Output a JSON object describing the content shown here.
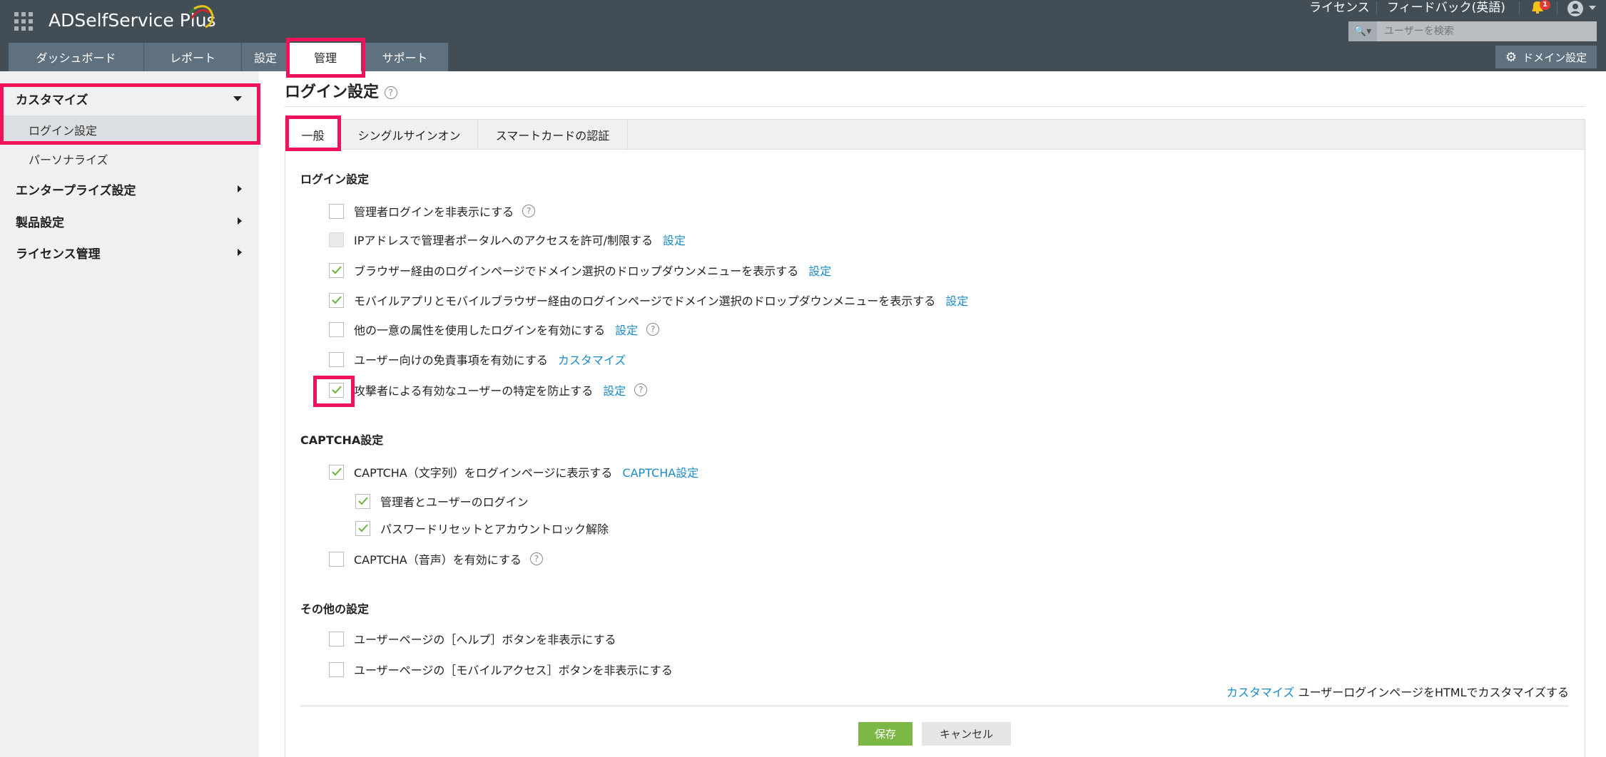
{
  "app": {
    "title": "ADSelfService Plus"
  },
  "top_links": {
    "license": "ライセンス",
    "feedback": "フィードバック(英語)",
    "notification_count": "1"
  },
  "search": {
    "placeholder": "ユーザーを検索"
  },
  "domain_settings": "ドメイン設定",
  "nav_tabs": [
    "ダッシュボード",
    "レポート",
    "設定",
    "管理",
    "サポート"
  ],
  "sidebar": {
    "customize": "カスタマイズ",
    "login_settings": "ログイン設定",
    "personalize": "パーソナライズ",
    "enterprise": "エンタープライズ設定",
    "product": "製品設定",
    "license": "ライセンス管理"
  },
  "page": {
    "title": "ログイン設定",
    "help": "?"
  },
  "content_tabs": [
    "一般",
    "シングルサインオン",
    "スマートカードの認証"
  ],
  "login_section": {
    "title": "ログイン設定",
    "items": [
      {
        "label": "管理者ログインを非表示にする",
        "checked": false
      },
      {
        "label": "IPアドレスで管理者ポータルへのアクセスを許可/制限する",
        "link": "設定",
        "checked": false
      },
      {
        "label": "ブラウザー経由のログインページでドメイン選択のドロップダウンメニューを表示する",
        "link": "設定",
        "checked": true
      },
      {
        "label": "モバイルアプリとモバイルブラウザー経由のログインページでドメイン選択のドロップダウンメニューを表示する",
        "link": "設定",
        "checked": true
      },
      {
        "label": "他の一意の属性を使用したログインを有効にする",
        "link": "設定",
        "checked": false
      },
      {
        "label": "ユーザー向けの免責事項を有効にする",
        "link": "カスタマイズ",
        "checked": false
      },
      {
        "label": "攻撃者による有効なユーザーの特定を防止する",
        "link": "設定",
        "checked": true
      }
    ]
  },
  "captcha_section": {
    "title": "CAPTCHA設定",
    "items": [
      {
        "label": "CAPTCHA（文字列）をログインページに表示する",
        "link": "CAPTCHA設定",
        "checked": true
      },
      {
        "label": "管理者とユーザーのログイン",
        "checked": true
      },
      {
        "label": "パスワードリセットとアカウントロック解除",
        "checked": true
      },
      {
        "label": "CAPTCHA（音声）を有効にする",
        "checked": false
      }
    ]
  },
  "other_section": {
    "title": "その他の設定",
    "items": [
      {
        "label": "ユーザーページの［ヘルプ］ボタンを非表示にする",
        "checked": false
      },
      {
        "label": "ユーザーページの［モバイルアクセス］ボタンを非表示にする",
        "checked": false
      }
    ]
  },
  "html_customize": {
    "link": "カスタマイズ",
    "text": "ユーザーログインページをHTMLでカスタマイズする"
  },
  "buttons": {
    "save": "保存",
    "cancel": "キャンセル"
  },
  "colors": {
    "header": "#434d55",
    "nav_tab": "#5f707e",
    "highlight": "#f2125a",
    "link": "#1a8bc7",
    "save": "#7cb846",
    "check": "#6cb33f"
  }
}
